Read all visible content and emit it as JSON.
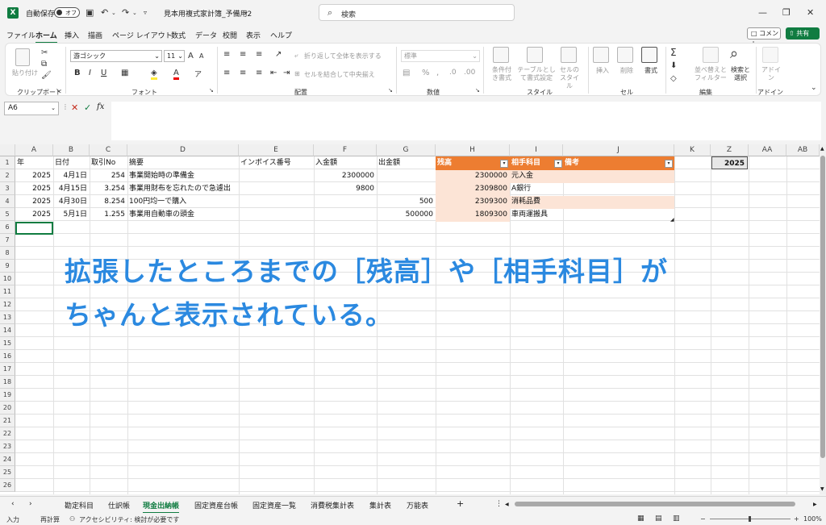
{
  "titlebar": {
    "autosave_label": "自動保存",
    "autosave_state": "オフ",
    "filename": "見本用複式家計簿_予備用2",
    "search_placeholder": "検索"
  },
  "menu": [
    "ファイル",
    "ホーム",
    "挿入",
    "描画",
    "ページ レイアウト",
    "数式",
    "データ",
    "校閲",
    "表示",
    "ヘルプ"
  ],
  "menu_active": "ホーム",
  "comment_label": "コメント",
  "share_label": "共有",
  "ribbon": {
    "clipboard": {
      "label": "クリップボード",
      "paste": "貼り付け"
    },
    "font": {
      "label": "フォント",
      "name": "游ゴシック",
      "size": "11"
    },
    "alignment": {
      "label": "配置",
      "wrap": "折り返して全体を表示する",
      "merge": "セルを結合して中央揃え"
    },
    "number": {
      "label": "数値",
      "format": "標準"
    },
    "styles": {
      "label": "スタイル",
      "cond": "条件付き書式",
      "table": "テーブルとして書式設定",
      "cellstyle": "セルのスタイル"
    },
    "cells": {
      "label": "セル",
      "insert": "挿入",
      "delete": "削除",
      "format": "書式"
    },
    "editing": {
      "label": "編集",
      "sort": "並べ替えとフィルター",
      "find": "検索と選択"
    },
    "addin": {
      "label": "アドイン",
      "btn": "アドイン"
    }
  },
  "namebox": "A6",
  "fx": "fx",
  "columns": [
    "A",
    "B",
    "C",
    "D",
    "E",
    "F",
    "G",
    "H",
    "I",
    "J",
    "K",
    "Z",
    "AA",
    "AB"
  ],
  "rows": [
    "1",
    "2",
    "3",
    "4",
    "5",
    "6",
    "7",
    "8",
    "9",
    "10",
    "11",
    "12",
    "13",
    "14",
    "15",
    "16",
    "17",
    "18",
    "19",
    "20",
    "21",
    "22",
    "23",
    "24",
    "25",
    "26"
  ],
  "headers": {
    "year": "年",
    "date": "日付",
    "no": "取引No",
    "desc": "摘要",
    "invoice": "インボイス番号",
    "in": "入金額",
    "out": "出金額",
    "bal": "残高",
    "acct": "相手科目",
    "note": "備考"
  },
  "table": [
    {
      "year": "2025",
      "date": "4月1日",
      "no": "254",
      "desc": "事業開始時の準備金",
      "in": "2300000",
      "out": "",
      "bal": "2300000",
      "acct": "元入金"
    },
    {
      "year": "2025",
      "date": "4月15日",
      "no": "3.254",
      "desc": "事業用財布を忘れたので急遽出",
      "in": "9800",
      "out": "",
      "bal": "2309800",
      "acct": "A銀行"
    },
    {
      "year": "2025",
      "date": "4月30日",
      "no": "8.254",
      "desc": "100円均一で購入",
      "in": "",
      "out": "500",
      "bal": "2309300",
      "acct": "消耗品費"
    },
    {
      "year": "2025",
      "date": "5月1日",
      "no": "1.255",
      "desc": "事業用自動車の頭金",
      "in": "",
      "out": "500000",
      "bal": "1809300",
      "acct": "車両運搬具"
    }
  ],
  "z1": "2025",
  "overlay": {
    "line1": "拡張したところまでの［残高］や［相手科目］が",
    "line2": "ちゃんと表示されている。"
  },
  "sheets": [
    "勘定科目",
    "仕訳帳",
    "現金出納帳",
    "固定資産台帳",
    "固定資産一覧",
    "消費税集計表",
    "集計表",
    "万能表"
  ],
  "sheet_active": "現金出納帳",
  "status": {
    "mode": "入力",
    "recalc": "再計算",
    "accessibility": "アクセシビリティ: 検討が必要です",
    "zoom": "100%"
  }
}
